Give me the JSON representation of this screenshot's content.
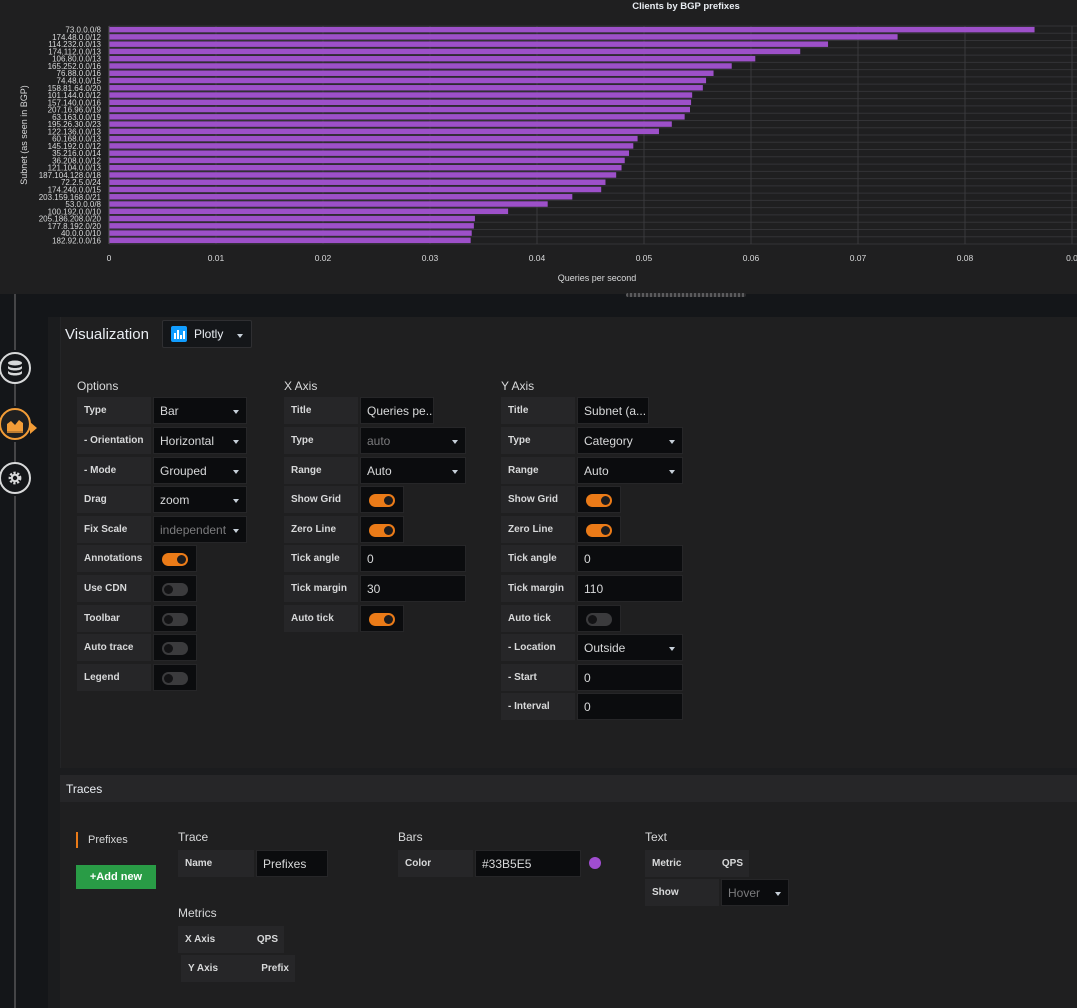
{
  "chart_data": {
    "type": "bar",
    "orientation": "horizontal",
    "title": "Clients by BGP prefixes",
    "xlabel": "Queries per second",
    "ylabel": "Subnet (as seen in BGP)",
    "xlim": [
      0,
      0.09
    ],
    "xticks": [
      "0",
      "0.01",
      "0.02",
      "0.03",
      "0.04",
      "0.05",
      "0.06",
      "0.07",
      "0.08",
      "0.0"
    ],
    "grid": true,
    "bar_color": "#9d50c9",
    "categories": [
      "73.0.0.0/8",
      "174.48.0.0/12",
      "114.232.0.0/13",
      "174.112.0.0/13",
      "106.80.0.0/13",
      "165.252.0.0/16",
      "76.88.0.0/16",
      "74.48.0.0/15",
      "158.81.64.0/20",
      "101.144.0.0/12",
      "157.140.0.0/16",
      "207.16.96.0/19",
      "63.163.0.0/19",
      "195.26.30.0/23",
      "122.136.0.0/13",
      "60.168.0.0/13",
      "145.192.0.0/12",
      "35.216.0.0/14",
      "36.208.0.0/12",
      "121.104.0.0/13",
      "187.104.128.0/18",
      "72.2.5.0/24",
      "174.240.0.0/15",
      "203.159.168.0/21",
      "53.0.0.0/8",
      "100.192.0.0/10",
      "205.186.208.0/20",
      "177.8.192.0/20",
      "40.0.0.0/10",
      "182.92.0.0/16"
    ],
    "values": [
      0.0865,
      0.0737,
      0.0672,
      0.0646,
      0.0604,
      0.0582,
      0.0565,
      0.0558,
      0.0555,
      0.0545,
      0.0544,
      0.0543,
      0.0538,
      0.0526,
      0.0514,
      0.0494,
      0.049,
      0.0486,
      0.0482,
      0.0479,
      0.0474,
      0.0464,
      0.046,
      0.0433,
      0.041,
      0.0373,
      0.0342,
      0.0341,
      0.0339,
      0.0338
    ]
  },
  "visualization": {
    "title": "Visualization",
    "plugin": "Plotly"
  },
  "options": {
    "title": "Options",
    "type": {
      "label": "Type",
      "value": "Bar"
    },
    "orientation": {
      "label": "- Orientation",
      "value": "Horizontal"
    },
    "mode": {
      "label": "- Mode",
      "value": "Grouped"
    },
    "drag": {
      "label": "Drag",
      "value": "zoom"
    },
    "fix_scale": {
      "label": "Fix Scale",
      "value": "independent"
    },
    "annotations": {
      "label": "Annotations",
      "on": true
    },
    "use_cdn": {
      "label": "Use CDN",
      "on": false
    },
    "toolbar": {
      "label": "Toolbar",
      "on": false
    },
    "auto_trace": {
      "label": "Auto trace",
      "on": false
    },
    "legend": {
      "label": "Legend",
      "on": false
    }
  },
  "x_axis": {
    "title": "X Axis",
    "axis_title": {
      "label": "Title",
      "value": "Queries pe..."
    },
    "type": {
      "label": "Type",
      "value": "auto"
    },
    "range": {
      "label": "Range",
      "value": "Auto"
    },
    "show_grid": {
      "label": "Show Grid",
      "on": true
    },
    "zero_line": {
      "label": "Zero Line",
      "on": true
    },
    "tick_angle": {
      "label": "Tick angle",
      "value": "0"
    },
    "tick_margin": {
      "label": "Tick margin",
      "value": "30"
    },
    "auto_tick": {
      "label": "Auto tick",
      "on": true
    }
  },
  "y_axis": {
    "title": "Y Axis",
    "axis_title": {
      "label": "Title",
      "value": "Subnet (a..."
    },
    "type": {
      "label": "Type",
      "value": "Category"
    },
    "range": {
      "label": "Range",
      "value": "Auto"
    },
    "show_grid": {
      "label": "Show Grid",
      "on": true
    },
    "zero_line": {
      "label": "Zero Line",
      "on": true
    },
    "tick_angle": {
      "label": "Tick angle",
      "value": "0"
    },
    "tick_margin": {
      "label": "Tick margin",
      "value": "110"
    },
    "auto_tick": {
      "label": "Auto tick",
      "on": false
    },
    "location": {
      "label": "- Location",
      "value": "Outside"
    },
    "start": {
      "label": "- Start",
      "value": "0"
    },
    "interval": {
      "label": "- Interval",
      "value": "0"
    }
  },
  "traces": {
    "title": "Traces",
    "tab": "Prefixes",
    "add_new": "+Add new",
    "trace_section": "Trace",
    "name": {
      "label": "Name",
      "value": "Prefixes"
    },
    "bars_section": "Bars",
    "color": {
      "label": "Color",
      "value": "#33B5E5",
      "swatch": "#a04dd0"
    },
    "text_section": "Text",
    "text_metric": {
      "label": "Metric",
      "value": "QPS"
    },
    "text_show": {
      "label": "Show",
      "value": "Hover"
    },
    "metrics_section": "Metrics",
    "x_metric": {
      "label": "X Axis",
      "value": "QPS"
    },
    "y_metric": {
      "label": "Y Axis",
      "value": "Prefix"
    }
  }
}
